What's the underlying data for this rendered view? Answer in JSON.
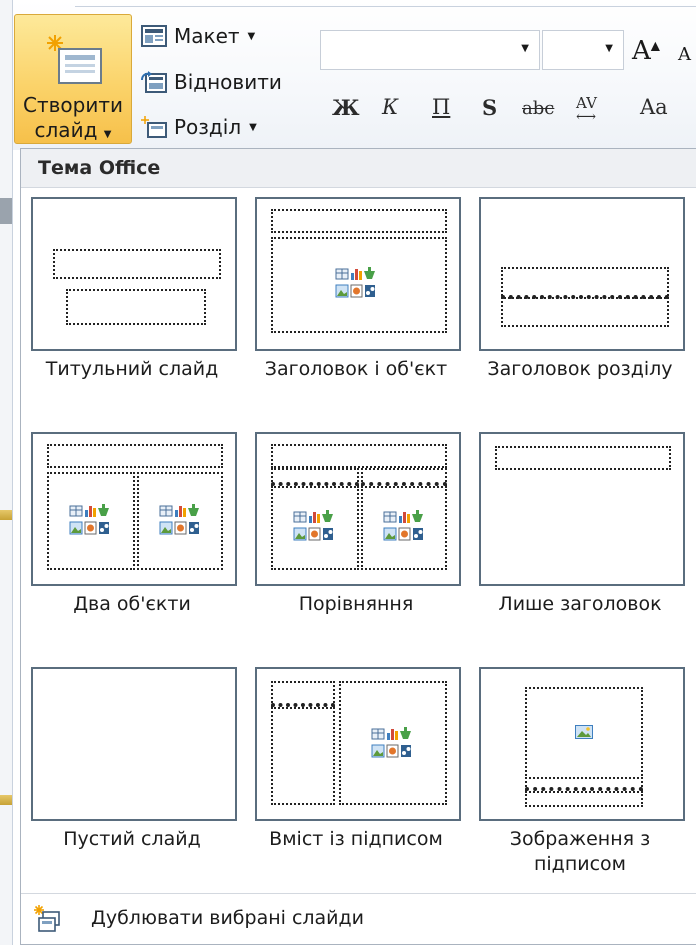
{
  "ribbon": {
    "new_slide": {
      "line1": "Створити",
      "line2": "слайд"
    },
    "layout_label": "Макет",
    "reset_label": "Відновити",
    "section_label": "Розділ",
    "font_name": "",
    "font_size": "",
    "grow_font": "A",
    "shrink_font": "A",
    "bold": "Ж",
    "italic": "К",
    "underline": "П",
    "shadow": "S",
    "strike": "abc",
    "spacing": "AV",
    "change_case": "Aa"
  },
  "dropdown": {
    "header": "Тема Office",
    "layouts": [
      {
        "label": "Титульний слайд"
      },
      {
        "label": "Заголовок і об'єкт"
      },
      {
        "label": "Заголовок розділу"
      },
      {
        "label": "Два об'єкти"
      },
      {
        "label": "Порівняння"
      },
      {
        "label": "Лише заголовок"
      },
      {
        "label": "Пустий слайд"
      },
      {
        "label": "Вміст із підписом"
      },
      {
        "label": "Зображення з підписом"
      }
    ],
    "footer_label": "Дублювати вибрані слайди",
    "footer_accel": "Д"
  },
  "colors": {
    "accent_button": "#fbd36a",
    "thumb_border": "#5a6d7e"
  }
}
